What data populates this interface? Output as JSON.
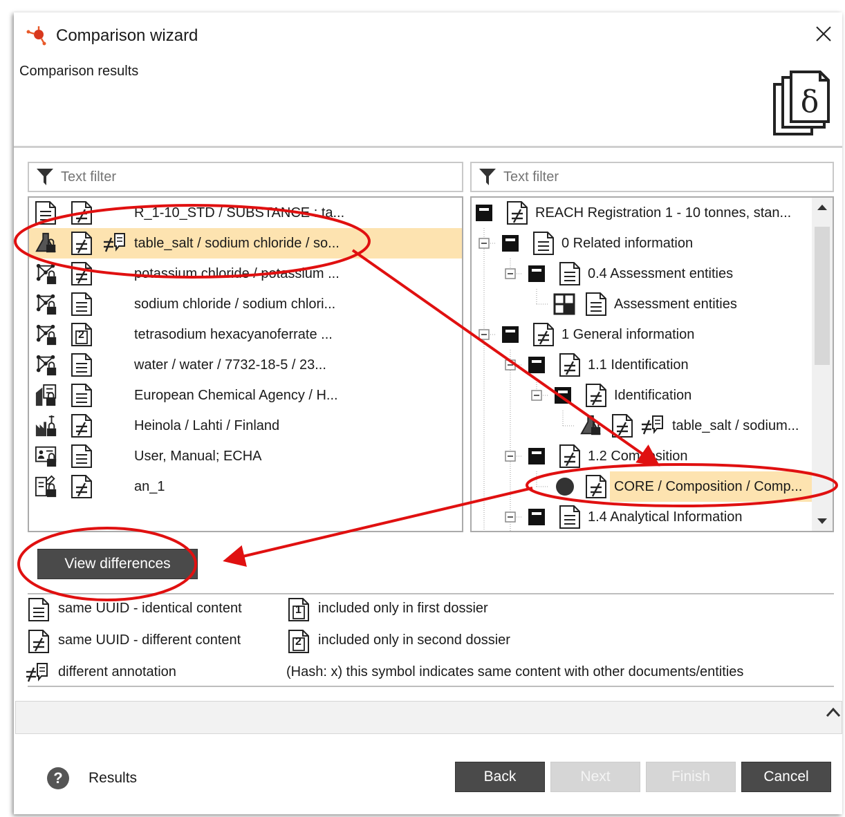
{
  "window": {
    "title": "Comparison wizard",
    "subtitle": "Comparison results"
  },
  "left_panel": {
    "filter_placeholder": "Text filter",
    "rows": [
      {
        "label": "R_1-10_STD / SUBSTANCE : ta..."
      },
      {
        "label": "table_salt / sodium chloride / so..."
      },
      {
        "label": "potassium chloride / potassium ..."
      },
      {
        "label": "sodium chloride / sodium chlori..."
      },
      {
        "label": "tetrasodium hexacyanoferrate ..."
      },
      {
        "label": "water / water / 7732-18-5 / 23..."
      },
      {
        "label": "European Chemical Agency / H..."
      },
      {
        "label": "Heinola / Lahti / Finland"
      },
      {
        "label": "User, Manual; ECHA"
      },
      {
        "label": "an_1"
      }
    ]
  },
  "right_panel": {
    "filter_placeholder": "Text filter",
    "rows": [
      {
        "label": "REACH Registration 1 - 10 tonnes, stan..."
      },
      {
        "label": "0 Related information"
      },
      {
        "label": "0.4 Assessment entities"
      },
      {
        "label": "Assessment entities"
      },
      {
        "label": "1 General information"
      },
      {
        "label": "1.1 Identification"
      },
      {
        "label": "Identification"
      },
      {
        "label": "table_salt / sodium..."
      },
      {
        "label": "1.2 Composition"
      },
      {
        "label": "CORE / Composition / Comp..."
      },
      {
        "label": "1.4 Analytical Information"
      }
    ]
  },
  "view_differences_label": "View differences",
  "legend": {
    "same_identical": "same UUID - identical content",
    "same_different": "same UUID - different content",
    "different_annotation": "different annotation",
    "only_first": "included only in first dossier",
    "only_second": "included only in second dossier",
    "hash_note": "(Hash: x) this symbol indicates same content with other documents/entities",
    "badge_1": "1",
    "badge_2": "2"
  },
  "footer": {
    "help_label": "Results",
    "help_icon": "?",
    "back": "Back",
    "next": "Next",
    "finish": "Finish",
    "cancel": "Cancel"
  },
  "colors": {
    "selection": "#fde3b0",
    "annotation_red": "#e01010",
    "button_dark": "#4a4a4a"
  }
}
